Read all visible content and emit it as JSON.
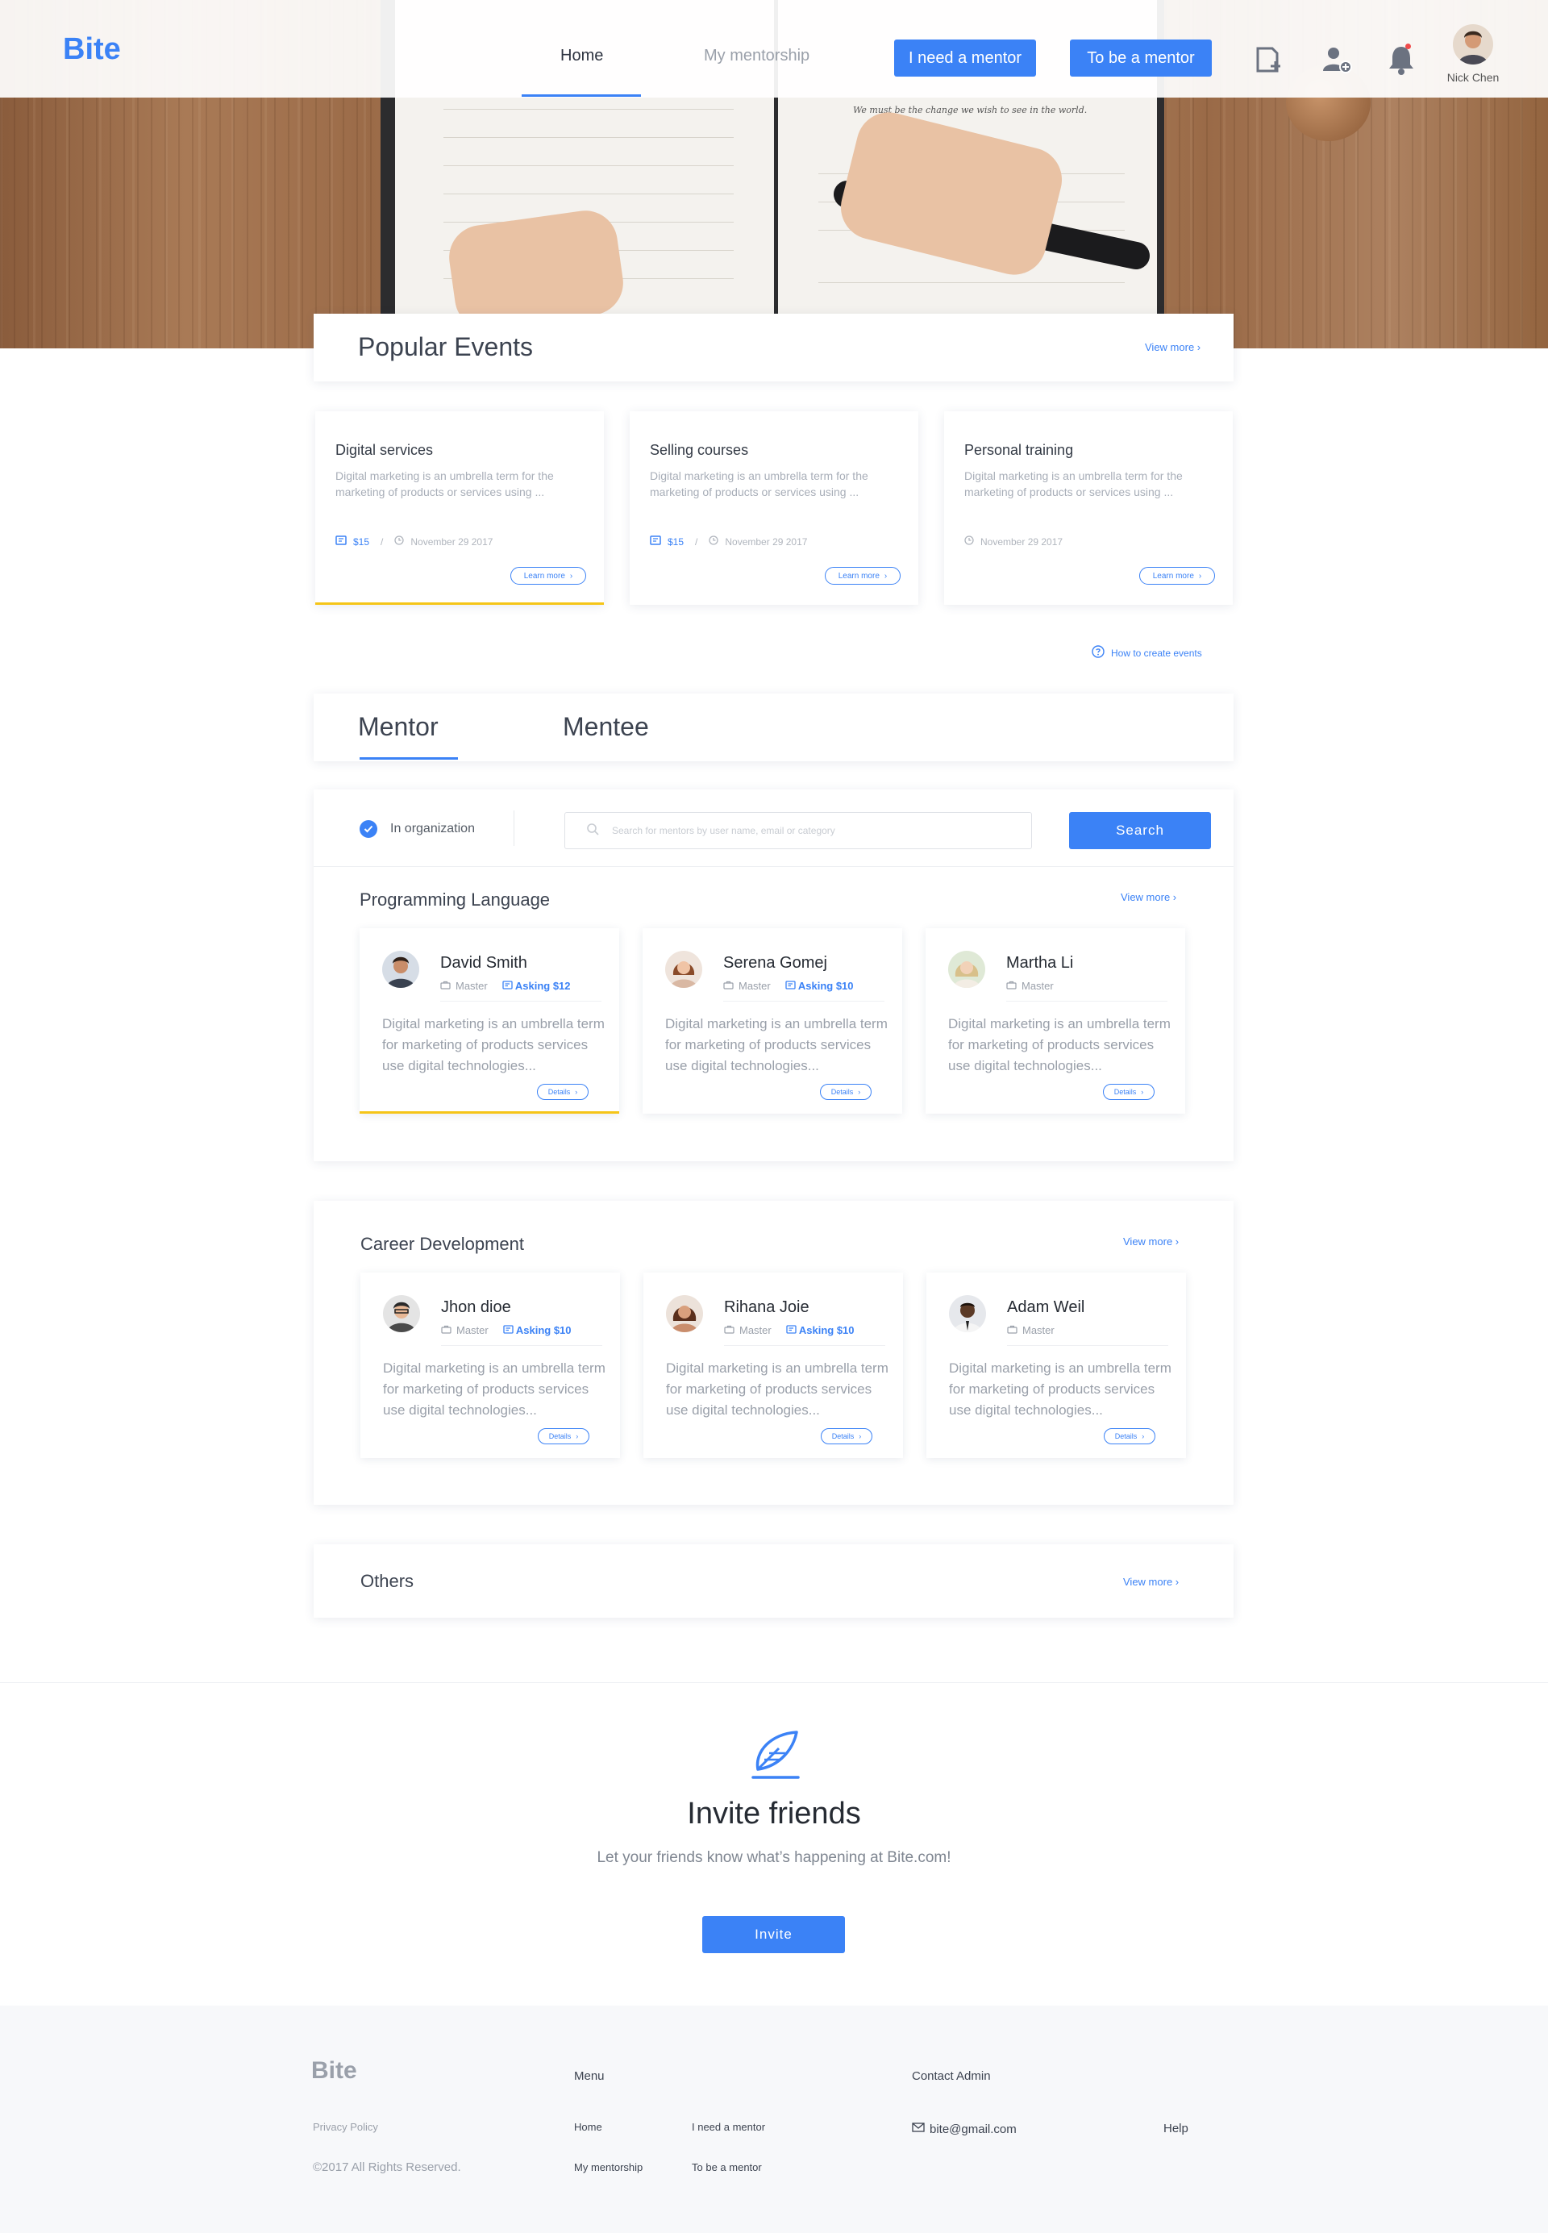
{
  "brand": {
    "name": "Bite",
    "accent": "#3b82f6",
    "highlight": "#f5c518"
  },
  "hero": {
    "quote": "We must be the change we wish to see in the world."
  },
  "header": {
    "nav": [
      {
        "label": "Home",
        "active": true
      },
      {
        "label": "My mentorship",
        "active": false
      }
    ],
    "buttons": {
      "need_mentor": "I need a mentor",
      "be_mentor": "To be a mentor"
    },
    "icons": [
      "add-event-icon",
      "add-user-icon",
      "bell-icon"
    ],
    "user": {
      "name": "Nick Chen"
    }
  },
  "popular_events": {
    "title": "Popular Events",
    "view_more": "View more",
    "cards": [
      {
        "title": "Digital services",
        "desc": "Digital marketing is an umbrella term for the marketing of products or services using ...",
        "price": "$15",
        "date": "November 29 2017",
        "cta": "Learn more",
        "highlighted": true
      },
      {
        "title": "Selling courses",
        "desc": "Digital marketing is an umbrella term for the marketing of products or services using ...",
        "price": "$15",
        "date": "November 29 2017",
        "cta": "Learn more",
        "highlighted": false
      },
      {
        "title": "Personal training",
        "desc": "Digital marketing is an umbrella term for the marketing of products or services using ...",
        "price": "",
        "date": "November 29 2017",
        "cta": "Learn more",
        "highlighted": false
      }
    ],
    "how_to": "How to create events"
  },
  "tabs": [
    {
      "label": "Mentor",
      "active": true
    },
    {
      "label": "Mentee",
      "active": false
    }
  ],
  "filter": {
    "checkbox_label": "In organization",
    "search_placeholder": "Search for mentors by user name, email or category",
    "search_button": "Search"
  },
  "groups": [
    {
      "title": "Programming Language",
      "view_more": "View more",
      "mentors": [
        {
          "name": "David Smith",
          "level": "Master",
          "asking": "Asking $12",
          "desc": "Digital marketing is an umbrella term  for marketing of products services use digital technologies...",
          "cta": "Details",
          "highlighted": true
        },
        {
          "name": "Serena Gomej",
          "level": "Master",
          "asking": "Asking $10",
          "desc": "Digital marketing is an umbrella term  for marketing of products services use digital technologies...",
          "cta": "Details",
          "highlighted": false
        },
        {
          "name": "Martha Li",
          "level": "Master",
          "asking": "",
          "desc": "Digital marketing is an umbrella term  for marketing of products services use digital technologies...",
          "cta": "Details",
          "highlighted": false
        }
      ]
    },
    {
      "title": "Career Development",
      "view_more": "View more",
      "mentors": [
        {
          "name": "Jhon dioe",
          "level": "Master",
          "asking": "Asking $10",
          "desc": "Digital marketing is an umbrella term  for marketing of products services use digital technologies...",
          "cta": "Details",
          "highlighted": false
        },
        {
          "name": "Rihana Joie",
          "level": "Master",
          "asking": "Asking $10",
          "desc": "Digital marketing is an umbrella term  for marketing of products services use digital technologies...",
          "cta": "Details",
          "highlighted": false
        },
        {
          "name": "Adam Weil",
          "level": "Master",
          "asking": "",
          "desc": "Digital marketing is an umbrella term  for marketing of products services use digital technologies...",
          "cta": "Details",
          "highlighted": false
        }
      ]
    },
    {
      "title": "Others",
      "view_more": "View more",
      "mentors": []
    }
  ],
  "invite": {
    "title": "Invite friends",
    "subtitle": "Let your friends know what’s happening at Bite.com!",
    "button": "Invite"
  },
  "footer": {
    "logo": "Bite",
    "privacy": "Privacy Policy",
    "copyright": "©2017 All Rights Reserved.",
    "menu_title": "Menu",
    "menu": [
      "Home",
      "I need a mentor",
      "My mentorship",
      "To be a mentor"
    ],
    "contact_title": "Contact Admin",
    "email": "bite@gmail.com",
    "help": "Help"
  }
}
